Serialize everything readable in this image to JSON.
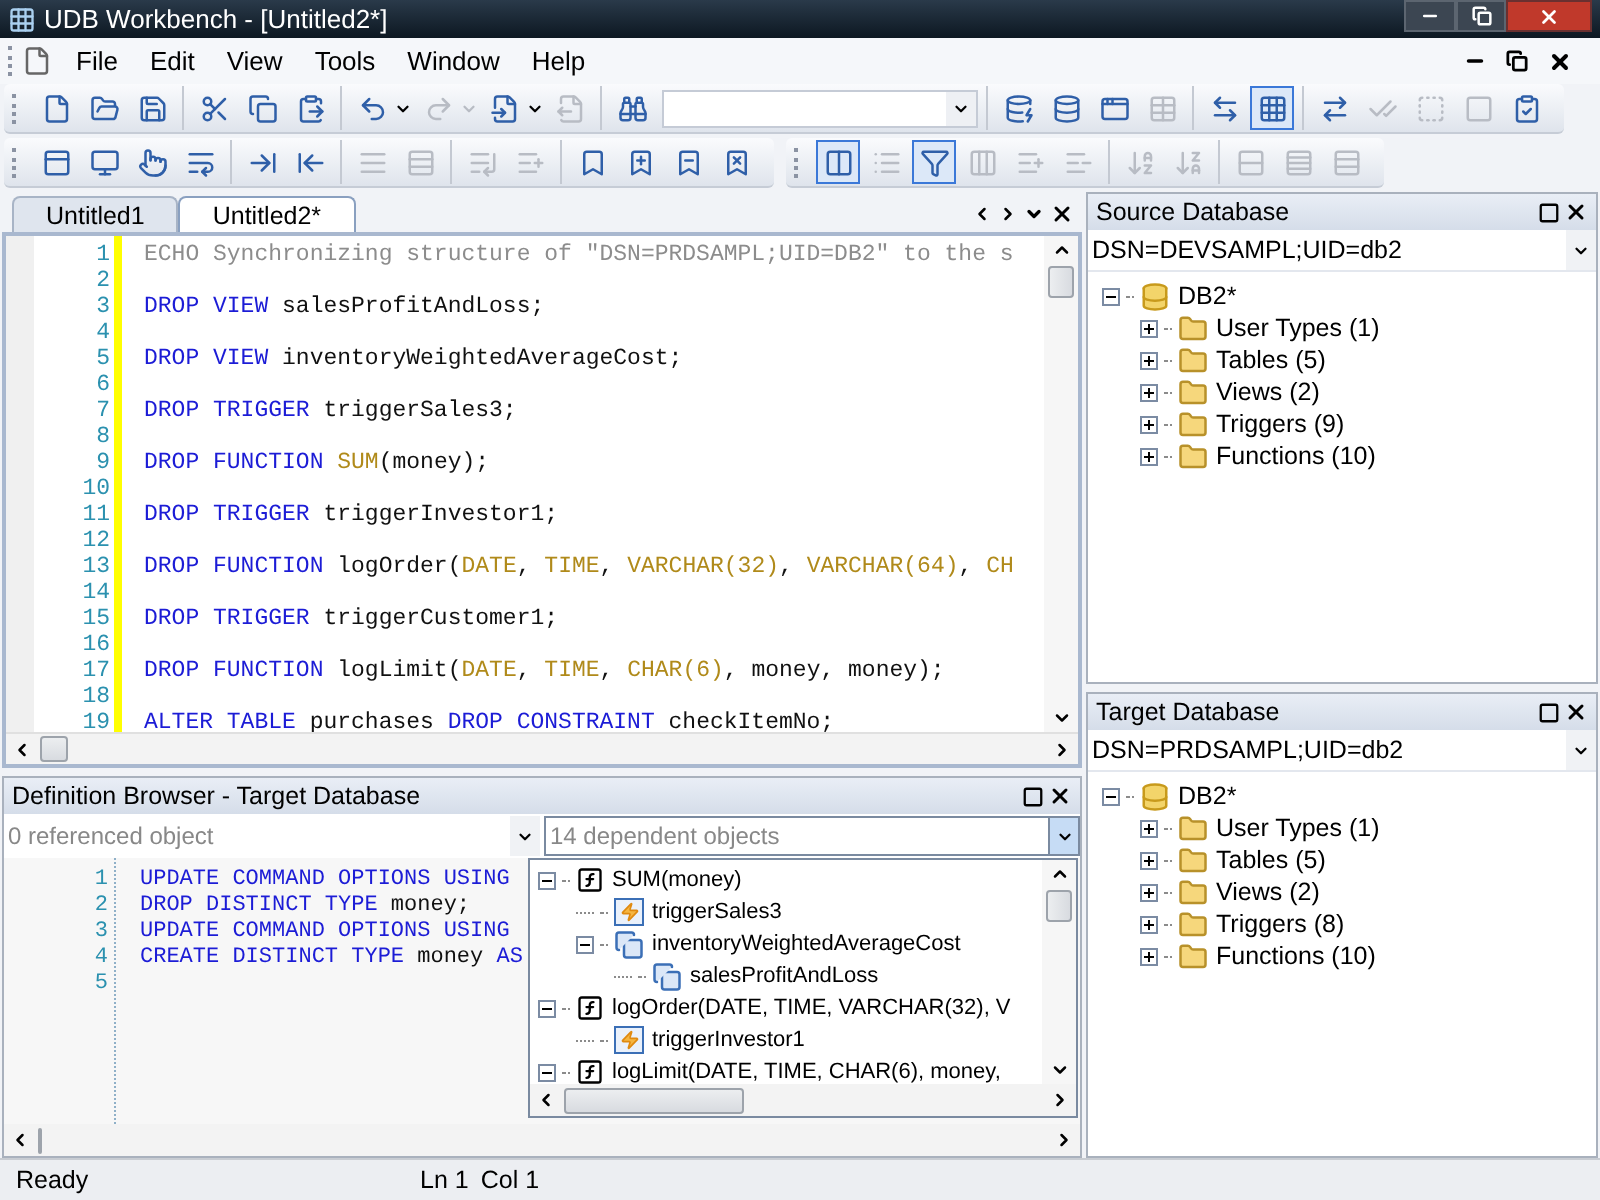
{
  "window": {
    "title": "UDB Workbench - [Untitled2*]"
  },
  "menu": [
    {
      "label": "File"
    },
    {
      "label": "Edit"
    },
    {
      "label": "View"
    },
    {
      "label": "Tools"
    },
    {
      "label": "Window"
    },
    {
      "label": "Help"
    }
  ],
  "toolbars": [
    {
      "groups": [
        [
          {
            "disabled": false
          },
          {
            "disabled": false
          },
          {
            "disabled": false
          }
        ],
        [
          {
            "disabled": false
          },
          {
            "disabled": false
          },
          {
            "disabled": false
          }
        ],
        [
          {
            "disabled": false,
            "dropdown": true
          },
          {
            "disabled": true,
            "dropdown": true
          },
          {
            "disabled": false,
            "dropdown": true
          },
          {
            "disabled": true
          }
        ],
        [
          {
            "disabled": false,
            "kind": "search"
          }
        ],
        [
          {
            "disabled": false
          },
          {
            "disabled": false
          },
          {
            "disabled": false
          },
          {
            "disabled": true
          }
        ],
        [
          {
            "disabled": false
          },
          {
            "disabled": false,
            "pressed": true
          }
        ],
        [
          {
            "disabled": false
          },
          {
            "disabled": true
          },
          {
            "disabled": true
          },
          {
            "disabled": true
          },
          {
            "disabled": false
          }
        ]
      ]
    },
    {
      "groups": [
        [
          {
            "disabled": false
          },
          {
            "disabled": false
          },
          {
            "disabled": false
          },
          {
            "disabled": false
          }
        ],
        [
          {
            "disabled": false
          },
          {
            "disabled": false
          }
        ],
        [
          {
            "disabled": true
          },
          {
            "disabled": true
          }
        ],
        [
          {
            "disabled": true
          },
          {
            "disabled": true
          }
        ],
        [
          {
            "disabled": false
          },
          {
            "disabled": false
          },
          {
            "disabled": false
          },
          {
            "disabled": false
          }
        ]
      ]
    },
    {
      "groups": [
        [
          {
            "disabled": false,
            "pressed": true
          },
          {
            "disabled": true
          },
          {
            "disabled": false,
            "pressed": true
          },
          {
            "disabled": true
          },
          {
            "disabled": true
          },
          {
            "disabled": true
          }
        ],
        [
          {
            "disabled": true
          },
          {
            "disabled": true
          }
        ],
        [
          {
            "disabled": true
          },
          {
            "disabled": true
          },
          {
            "disabled": true
          }
        ]
      ]
    }
  ],
  "editor": {
    "tabs": [
      {
        "label": "Untitled1",
        "selected": false
      },
      {
        "label": "Untitled2*",
        "selected": true
      }
    ],
    "lines": [
      {
        "number": "1",
        "tokens": [
          {
            "t": "ECHO Synchronizing structure of \"DSN=PRDSAMPL;UID=DB2\" to the s",
            "kind": "comment"
          }
        ]
      },
      {
        "number": "2"
      },
      {
        "number": "3",
        "tokens": [
          {
            "t": "DROP VIEW ",
            "kind": "kw"
          },
          {
            "t": "salesProfitAndLoss;",
            "kind": "plain"
          }
        ]
      },
      {
        "number": "4"
      },
      {
        "number": "5",
        "tokens": [
          {
            "t": "DROP VIEW ",
            "kind": "kw"
          },
          {
            "t": "inventoryWeightedAverageCost;",
            "kind": "plain"
          }
        ]
      },
      {
        "number": "6"
      },
      {
        "number": "7",
        "tokens": [
          {
            "t": "DROP TRIGGER ",
            "kind": "kw"
          },
          {
            "t": "triggerSales3;",
            "kind": "plain"
          }
        ]
      },
      {
        "number": "8"
      },
      {
        "number": "9",
        "tokens": [
          {
            "t": "DROP FUNCTION ",
            "kind": "kw"
          },
          {
            "t": "SUM",
            "kind": "type"
          },
          {
            "t": "(money);",
            "kind": "plain"
          }
        ]
      },
      {
        "number": "10"
      },
      {
        "number": "11",
        "tokens": [
          {
            "t": "DROP TRIGGER ",
            "kind": "kw"
          },
          {
            "t": "triggerInvestor1;",
            "kind": "plain"
          }
        ]
      },
      {
        "number": "12"
      },
      {
        "number": "13",
        "tokens": [
          {
            "t": "DROP FUNCTION ",
            "kind": "kw"
          },
          {
            "t": "logOrder(",
            "kind": "plain"
          },
          {
            "t": "DATE",
            "kind": "type"
          },
          {
            "t": ", ",
            "kind": "plain"
          },
          {
            "t": "TIME",
            "kind": "type"
          },
          {
            "t": ", ",
            "kind": "plain"
          },
          {
            "t": "VARCHAR(32)",
            "kind": "type"
          },
          {
            "t": ", ",
            "kind": "plain"
          },
          {
            "t": "VARCHAR(64)",
            "kind": "type"
          },
          {
            "t": ", ",
            "kind": "plain"
          },
          {
            "t": "CH",
            "kind": "type"
          }
        ]
      },
      {
        "number": "14"
      },
      {
        "number": "15",
        "tokens": [
          {
            "t": "DROP TRIGGER ",
            "kind": "kw"
          },
          {
            "t": "triggerCustomer1;",
            "kind": "plain"
          }
        ]
      },
      {
        "number": "16"
      },
      {
        "number": "17",
        "tokens": [
          {
            "t": "DROP FUNCTION ",
            "kind": "kw"
          },
          {
            "t": "logLimit(",
            "kind": "plain"
          },
          {
            "t": "DATE",
            "kind": "type"
          },
          {
            "t": ", ",
            "kind": "plain"
          },
          {
            "t": "TIME",
            "kind": "type"
          },
          {
            "t": ", ",
            "kind": "plain"
          },
          {
            "t": "CHAR(6)",
            "kind": "type"
          },
          {
            "t": ", money, money);",
            "kind": "plain"
          }
        ]
      },
      {
        "number": "18"
      },
      {
        "number": "19",
        "tokens": [
          {
            "t": "ALTER TABLE ",
            "kind": "kw"
          },
          {
            "t": "purchases ",
            "kind": "plain"
          },
          {
            "t": "DROP CONSTRAINT ",
            "kind": "kw"
          },
          {
            "t": "checkItemNo;",
            "kind": "plain"
          }
        ]
      }
    ]
  },
  "definition_browser": {
    "title": "Definition Browser - Target Database",
    "referenced": {
      "placeholder": "0 referenced object"
    },
    "dependent": {
      "placeholder": "14 dependent objects",
      "expanded": true
    },
    "lines": [
      {
        "number": "1",
        "tokens": [
          {
            "t": "UPDATE COMMAND OPTIONS USING",
            "kind": "kw"
          }
        ]
      },
      {
        "number": "2",
        "tokens": [
          {
            "t": "DROP DISTINCT TYPE ",
            "kind": "kw"
          },
          {
            "t": "money;",
            "kind": "plain"
          }
        ]
      },
      {
        "number": "3",
        "tokens": [
          {
            "t": "UPDATE COMMAND OPTIONS USING",
            "kind": "kw"
          }
        ]
      },
      {
        "number": "4",
        "tokens": [
          {
            "t": "CREATE DISTINCT TYPE ",
            "kind": "kw"
          },
          {
            "t": "money ",
            "kind": "plain"
          },
          {
            "t": "AS",
            "kind": "kw"
          }
        ]
      },
      {
        "number": "5"
      }
    ],
    "dependents": [
      {
        "label": "SUM(money)",
        "kind": "function",
        "expanded": true,
        "children": [
          {
            "label": "triggerSales3",
            "kind": "trigger"
          },
          {
            "label": "inventoryWeightedAverageCost",
            "kind": "view",
            "expanded": true,
            "children": [
              {
                "label": "salesProfitAndLoss",
                "kind": "view"
              }
            ]
          }
        ]
      },
      {
        "label": "logOrder(DATE, TIME, VARCHAR(32), V",
        "kind": "function",
        "expanded": true,
        "children": [
          {
            "label": "triggerInvestor1",
            "kind": "trigger"
          }
        ]
      },
      {
        "label": "logLimit(DATE, TIME, CHAR(6), money,",
        "kind": "function",
        "expanded": true
      }
    ]
  },
  "source_database": {
    "title": "Source Database",
    "connection": "DSN=DEVSAMPL;UID=db2",
    "tree": [
      {
        "label": "DB2*",
        "kind": "database",
        "expanded": true,
        "children": [
          {
            "label": "User Types (1)",
            "kind": "folder",
            "expanded": false
          },
          {
            "label": "Tables (5)",
            "kind": "folder",
            "expanded": false
          },
          {
            "label": "Views (2)",
            "kind": "folder",
            "expanded": false
          },
          {
            "label": "Triggers (9)",
            "kind": "folder",
            "expanded": false
          },
          {
            "label": "Functions (10)",
            "kind": "folder",
            "expanded": false
          }
        ]
      }
    ]
  },
  "target_database": {
    "title": "Target Database",
    "connection": "DSN=PRDSAMPL;UID=db2",
    "tree": [
      {
        "label": "DB2*",
        "kind": "database",
        "expanded": true,
        "children": [
          {
            "label": "User Types (1)",
            "kind": "folder",
            "expanded": false
          },
          {
            "label": "Tables (5)",
            "kind": "folder",
            "expanded": false
          },
          {
            "label": "Views (2)",
            "kind": "folder",
            "expanded": false
          },
          {
            "label": "Triggers (8)",
            "kind": "folder",
            "expanded": false
          },
          {
            "label": "Functions (10)",
            "kind": "folder",
            "expanded": false
          }
        ]
      }
    ]
  },
  "status_bar": {
    "message": "Ready",
    "line": "Ln 1",
    "column": "Col 1"
  }
}
